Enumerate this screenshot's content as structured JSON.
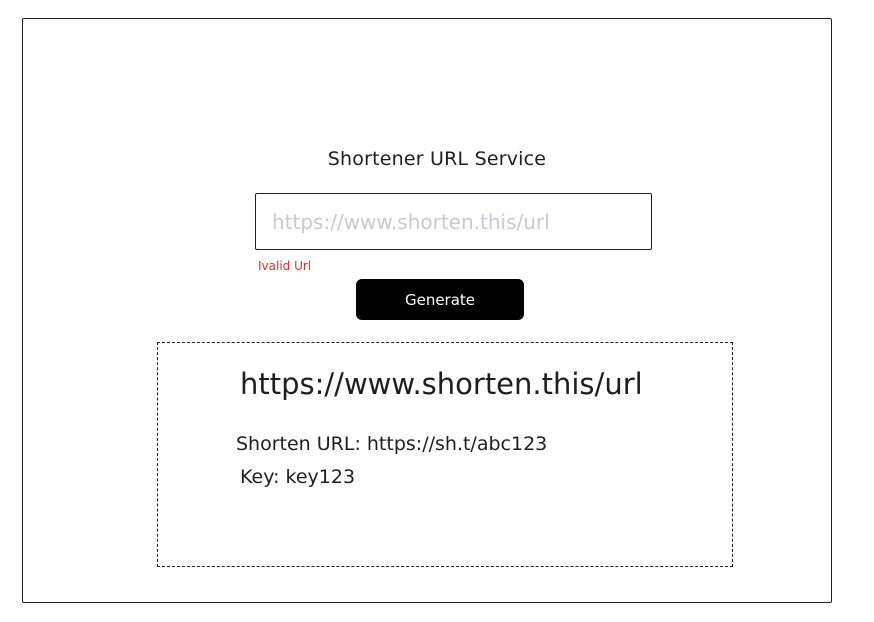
{
  "page": {
    "title": "Shortener URL Service"
  },
  "form": {
    "url_placeholder": "https://www.shorten.this/url",
    "url_value": "",
    "error_message": "Ivalid Url",
    "generate_label": "Generate"
  },
  "result": {
    "original_url": "https://www.shorten.this/url",
    "short_url_text": "Shorten URL: https://sh.t/abc123",
    "key_text": "Key: key123"
  },
  "colors": {
    "error": "#e03131",
    "button_bg": "#000000",
    "placeholder": "#c5c9d1"
  }
}
